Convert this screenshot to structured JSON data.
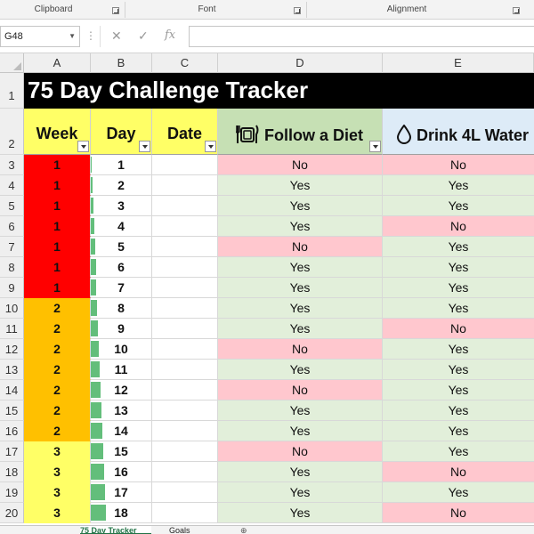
{
  "ribbon": {
    "groups": [
      {
        "label": "Clipboard"
      },
      {
        "label": "Font"
      },
      {
        "label": "Alignment"
      }
    ]
  },
  "formula_bar": {
    "name_box": "G48",
    "cancel_icon": "✕",
    "enter_icon": "✓",
    "fx_icon": "fx",
    "formula": ""
  },
  "columns": [
    "A",
    "B",
    "C",
    "D",
    "E"
  ],
  "rows": [
    "1",
    "2",
    "3",
    "4",
    "5",
    "6",
    "7",
    "8",
    "9",
    "10",
    "11",
    "12",
    "13",
    "14",
    "15",
    "16",
    "17",
    "18",
    "19",
    "20"
  ],
  "title": "75 Day Challenge Tracker",
  "headers": {
    "week": "Week",
    "day": "Day",
    "date": "Date",
    "diet": "Follow a Diet",
    "diet_icon": "plate-cutlery-icon",
    "water": "Drink 4L Water",
    "water_icon": "water-drop-icon"
  },
  "colors": {
    "week1": "#ff0000",
    "week2": "#ffc000",
    "week3": "#ffff66",
    "yes_fill": "#e2efda",
    "no_fill": "#ffc7ce",
    "bar": "#63be7b",
    "header_yellow": "#ffff66",
    "header_green": "#c6e0b4",
    "header_blue": "#ddebf7"
  },
  "records": [
    {
      "week": "1",
      "day": "1",
      "date": "",
      "diet": "No",
      "water": "No"
    },
    {
      "week": "1",
      "day": "2",
      "date": "",
      "diet": "Yes",
      "water": "Yes"
    },
    {
      "week": "1",
      "day": "3",
      "date": "",
      "diet": "Yes",
      "water": "Yes"
    },
    {
      "week": "1",
      "day": "4",
      "date": "",
      "diet": "Yes",
      "water": "No"
    },
    {
      "week": "1",
      "day": "5",
      "date": "",
      "diet": "No",
      "water": "Yes"
    },
    {
      "week": "1",
      "day": "6",
      "date": "",
      "diet": "Yes",
      "water": "Yes"
    },
    {
      "week": "1",
      "day": "7",
      "date": "",
      "diet": "Yes",
      "water": "Yes"
    },
    {
      "week": "2",
      "day": "8",
      "date": "",
      "diet": "Yes",
      "water": "Yes"
    },
    {
      "week": "2",
      "day": "9",
      "date": "",
      "diet": "Yes",
      "water": "No"
    },
    {
      "week": "2",
      "day": "10",
      "date": "",
      "diet": "No",
      "water": "Yes"
    },
    {
      "week": "2",
      "day": "11",
      "date": "",
      "diet": "Yes",
      "water": "Yes"
    },
    {
      "week": "2",
      "day": "12",
      "date": "",
      "diet": "No",
      "water": "Yes"
    },
    {
      "week": "2",
      "day": "13",
      "date": "",
      "diet": "Yes",
      "water": "Yes"
    },
    {
      "week": "2",
      "day": "14",
      "date": "",
      "diet": "Yes",
      "water": "Yes"
    },
    {
      "week": "3",
      "day": "15",
      "date": "",
      "diet": "No",
      "water": "Yes"
    },
    {
      "week": "3",
      "day": "16",
      "date": "",
      "diet": "Yes",
      "water": "No"
    },
    {
      "week": "3",
      "day": "17",
      "date": "",
      "diet": "Yes",
      "water": "Yes"
    },
    {
      "week": "3",
      "day": "18",
      "date": "",
      "diet": "Yes",
      "water": "No"
    }
  ],
  "day_bar_max": 75,
  "sheet_tabs": [
    {
      "label": "75 Day Tracker",
      "active": true
    },
    {
      "label": "Goals",
      "active": false
    }
  ]
}
